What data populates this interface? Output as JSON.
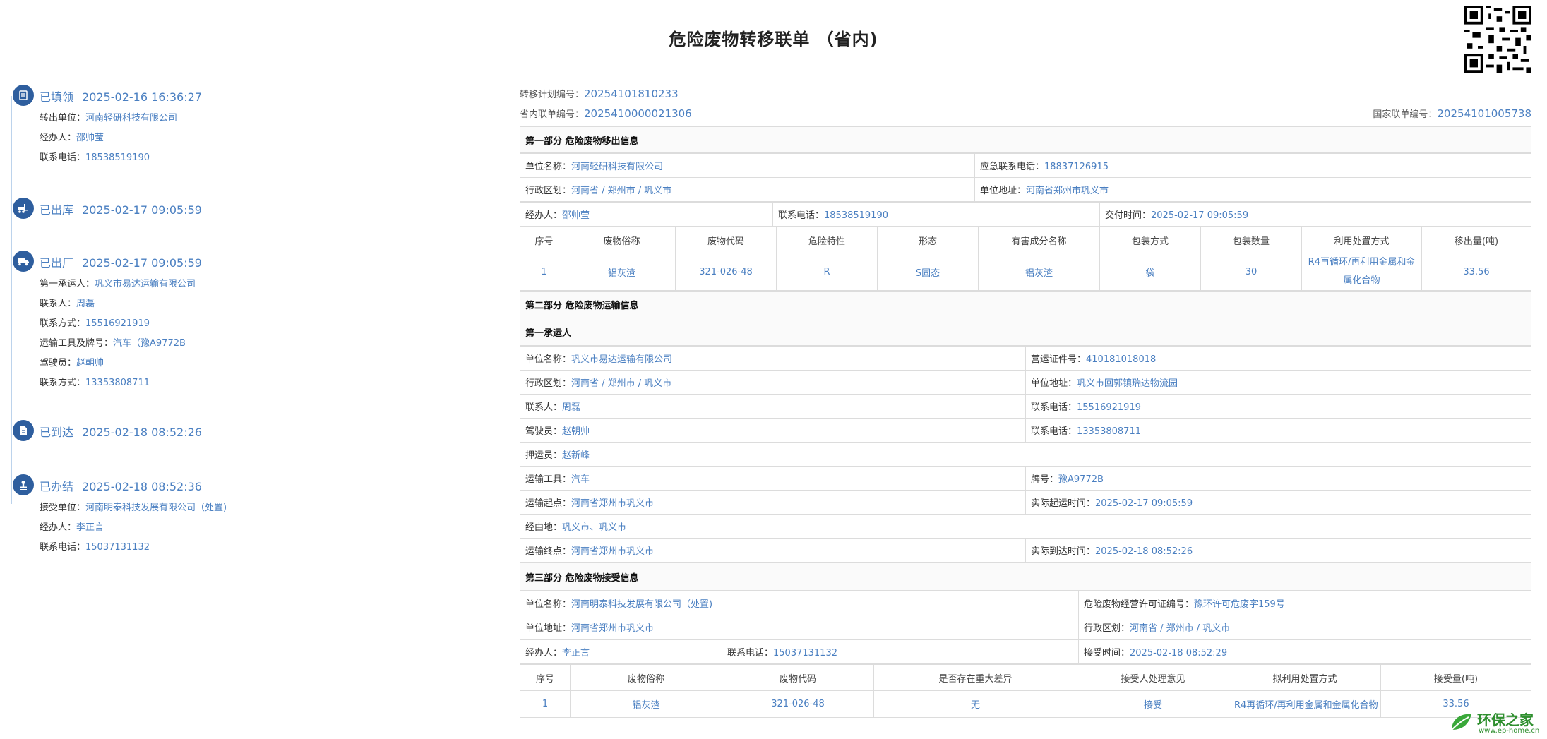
{
  "title": "危险废物转移联单 （省内)",
  "timeline": [
    {
      "status": "已填领",
      "time": "2025-02-16 16:36:27",
      "icon": "form-icon",
      "rows": [
        [
          "转出单位：",
          "河南轻研科技有限公司"
        ],
        [
          "经办人：",
          "邵帅莹"
        ],
        [
          "联系电话：",
          "18538519190"
        ]
      ]
    },
    {
      "status": "已出库",
      "time": "2025-02-17 09:05:59",
      "icon": "forklift-icon",
      "rows": []
    },
    {
      "status": "已出厂",
      "time": "2025-02-17 09:05:59",
      "icon": "truck-icon",
      "rows": [
        [
          "第一承运人：",
          "巩义市易达运输有限公司"
        ],
        [
          "联系人：",
          "周磊"
        ],
        [
          "联系方式：",
          "15516921919"
        ],
        [
          "运输工具及牌号：",
          "汽车（豫A9772B"
        ],
        [
          "驾驶员：",
          "赵朝帅"
        ],
        [
          "联系方式：",
          "13353808711"
        ]
      ]
    },
    {
      "status": "已到达",
      "time": "2025-02-18 08:52:26",
      "icon": "document-icon",
      "rows": []
    },
    {
      "status": "已办结",
      "time": "2025-02-18 08:52:36",
      "icon": "stamp-icon",
      "rows": [
        [
          "接受单位：",
          "河南明泰科技发展有限公司（处置)"
        ],
        [
          "经办人：",
          "李正言"
        ],
        [
          "联系电话：",
          "15037131132"
        ]
      ]
    }
  ],
  "header": {
    "plan_label": "转移计划编号：",
    "plan_no": "20254101810233",
    "prov_label": "省内联单编号：",
    "prov_no": "2025410000021306",
    "nat_label": "国家联单编号：",
    "nat_no": "20254101005738"
  },
  "part1": {
    "title": "第一部分 危险废物移出信息",
    "unit_label": "单位名称：",
    "unit": "河南轻研科技有限公司",
    "emerg_label": "应急联系电话：",
    "emerg": "18837126915",
    "region_label": "行政区划：",
    "region": "河南省 / 郑州市 / 巩义市",
    "addr_label": "单位地址：",
    "addr": "河南省郑州市巩义市",
    "handler_label": "经办人：",
    "handler": "邵帅莹",
    "phone_label": "联系电话：",
    "phone": "18538519190",
    "time_label": "交付时间：",
    "time": "2025-02-17 09:05:59",
    "columns": [
      "序号",
      "废物俗称",
      "废物代码",
      "危险特性",
      "形态",
      "有害成分名称",
      "包装方式",
      "包装数量",
      "利用处置方式",
      "移出量(吨)"
    ],
    "rows": [
      [
        "1",
        "铝灰渣",
        "321-026-48",
        "R",
        "S固态",
        "铝灰渣",
        "袋",
        "30",
        "R4再循环/再利用金属和金属化合物",
        "33.56"
      ]
    ]
  },
  "part2": {
    "title": "第二部分 危险废物运输信息",
    "carrier_title": "第一承运人",
    "rows": [
      [
        [
          "单位名称：",
          "巩义市易达运输有限公司"
        ],
        [
          "营运证件号：",
          "410181018018"
        ]
      ],
      [
        [
          "行政区划：",
          "河南省 / 郑州市 / 巩义市"
        ],
        [
          "单位地址：",
          "巩义市回郭镇瑞达物流园"
        ]
      ],
      [
        [
          "联系人：",
          "周磊"
        ],
        [
          "联系电话：",
          "15516921919"
        ]
      ],
      [
        [
          "驾驶员：",
          "赵朝帅"
        ],
        [
          "联系电话：",
          "13353808711"
        ]
      ],
      [
        [
          "押运员：",
          "赵新峰"
        ]
      ],
      [
        [
          "运输工具：",
          "汽车"
        ],
        [
          "牌号：",
          "豫A9772B"
        ]
      ],
      [
        [
          "运输起点：",
          "河南省郑州市巩义市"
        ],
        [
          "实际起运时间：",
          "2025-02-17 09:05:59"
        ]
      ],
      [
        [
          "经由地：",
          "巩义市、巩义市"
        ]
      ],
      [
        [
          "运输终点：",
          "河南省郑州市巩义市"
        ],
        [
          "实际到达时间：",
          "2025-02-18 08:52:26"
        ]
      ]
    ]
  },
  "part3": {
    "title": "第三部分 危险废物接受信息",
    "unit_label": "单位名称：",
    "unit": "河南明泰科技发展有限公司（处置)",
    "license_label": "危险废物经营许可证编号：",
    "license": "豫环许可危废字159号",
    "addr_label": "单位地址：",
    "addr": "河南省郑州市巩义市",
    "region_label": "行政区划：",
    "region": "河南省 / 郑州市 / 巩义市",
    "handler_label": "经办人：",
    "handler": "李正言",
    "phone_label": "联系电话：",
    "phone": "15037131132",
    "time_label": "接受时间：",
    "time": "2025-02-18 08:52:29",
    "columns": [
      "序号",
      "废物俗称",
      "废物代码",
      "是否存在重大差异",
      "接受人处理意见",
      "拟利用处置方式",
      "接受量(吨)"
    ],
    "rows": [
      [
        "1",
        "铝灰渣",
        "321-026-48",
        "无",
        "接受",
        "R4再循环/再利用金属和金属化合物",
        "33.56"
      ]
    ]
  },
  "watermark": {
    "name": "环保之家",
    "url": "www.ep-home.cn"
  }
}
